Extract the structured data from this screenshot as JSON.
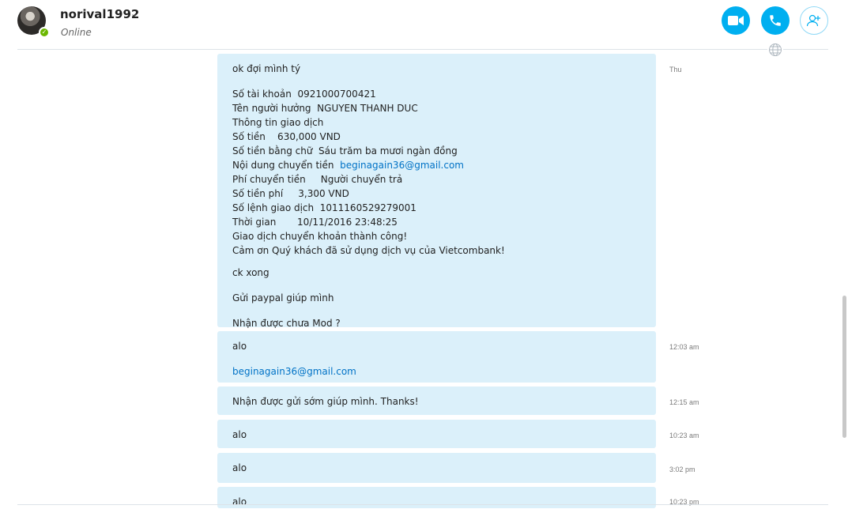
{
  "header": {
    "username": "norival1992",
    "status": "Online"
  },
  "messages": [
    {
      "time": "Thu",
      "lines": {
        "l1": "ok đợi mình tý",
        "acct": "Số tài khoản  0921000700421",
        "name": "Tên người hưởng  NGUYEN THANH DUC",
        "info": "Thông tin giao dịch",
        "amount": "Số tiền    630,000 VND",
        "words": "Số tiền bằng chữ  Sáu trăm ba mươi ngàn đồng",
        "content_label": "Nội dung chuyển tiền  ",
        "content_link": "beginagain36@gmail.com",
        "fee_type": "Phí chuyển tiền     Người chuyển trả",
        "fee": "Số tiền phí     3,300 VND",
        "order": "Số lệnh giao dịch  1011160529279001",
        "datetime": "Thời gian       10/11/2016 23:48:25",
        "success": "Giao dịch chuyển khoản thành công!",
        "thanks": "Cảm ơn Quý khách đã sử dụng dịch vụ của Vietcombank!",
        "ck": "ck xong",
        "paypal": "Gửi paypal giúp mình",
        "mod": "Nhận được chưa Mod ?"
      }
    },
    {
      "time": "12:03 am",
      "text": "alo",
      "link": "beginagain36@gmail.com"
    },
    {
      "time": "12:15 am",
      "text": "Nhận được gửi sớm giúp mình. Thanks!"
    },
    {
      "time": "10:23 am",
      "text": "alo"
    },
    {
      "time": "3:02 pm",
      "text": "alo"
    },
    {
      "time": "10:23 pm",
      "text": "alo"
    }
  ]
}
